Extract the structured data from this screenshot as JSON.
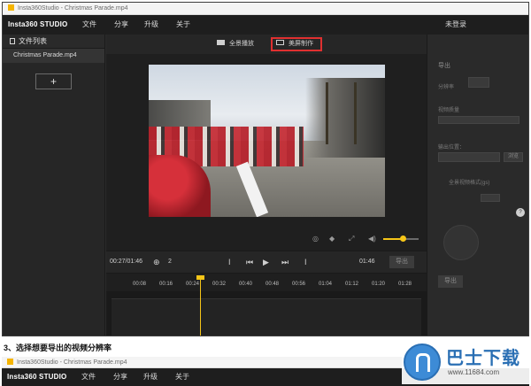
{
  "window": {
    "title": "Insta360Studio - Christmas Parade.mp4"
  },
  "menubar": {
    "brand": "Insta360 STUDIO",
    "items": [
      "文件",
      "分享",
      "升级",
      "关于"
    ],
    "login": "未登录"
  },
  "sidebar": {
    "header": "文件列表",
    "files": [
      "Christmas Parade.mp4"
    ],
    "add_label": "+"
  },
  "toolbar": {
    "fullscreen_label": "全景播放",
    "clip_label": "美屏制作"
  },
  "video_controls": {
    "icons": [
      "settings-icon",
      "vr-glasses-icon",
      "expand-icon",
      "volume-icon"
    ],
    "volume_level": 0.55
  },
  "playback": {
    "current_time": "00:27/01:46",
    "marker_label": "2",
    "duration": "01:46",
    "export_label": "导出"
  },
  "timeline": {
    "ticks": [
      "00:08",
      "00:16",
      "00:24",
      "00:32",
      "00:40",
      "00:48",
      "00:56",
      "01:04",
      "01:12",
      "01:20",
      "01:28"
    ],
    "playhead_time": "00:24"
  },
  "right_panel": {
    "header": "导出",
    "labels": [
      "分辨率",
      "视频质量",
      "输出位置：",
      "全景视频格式(gs)"
    ],
    "browse_label": "浏览",
    "export_label": "导出",
    "info_badge": "?"
  },
  "caption": "3、选择想要导出的视频分辨率",
  "window2": {
    "title": "Insta360Studio - Christmas Parade.mp4",
    "brand": "Insta360 STUDIO",
    "items": [
      "文件",
      "分享",
      "升级",
      "关于"
    ]
  },
  "watermark": {
    "text": "巴士下载",
    "url": "www.11684.com"
  },
  "colors": {
    "accent": "#f5c518",
    "highlight": "#e03030",
    "background": "#2b2b2b"
  }
}
